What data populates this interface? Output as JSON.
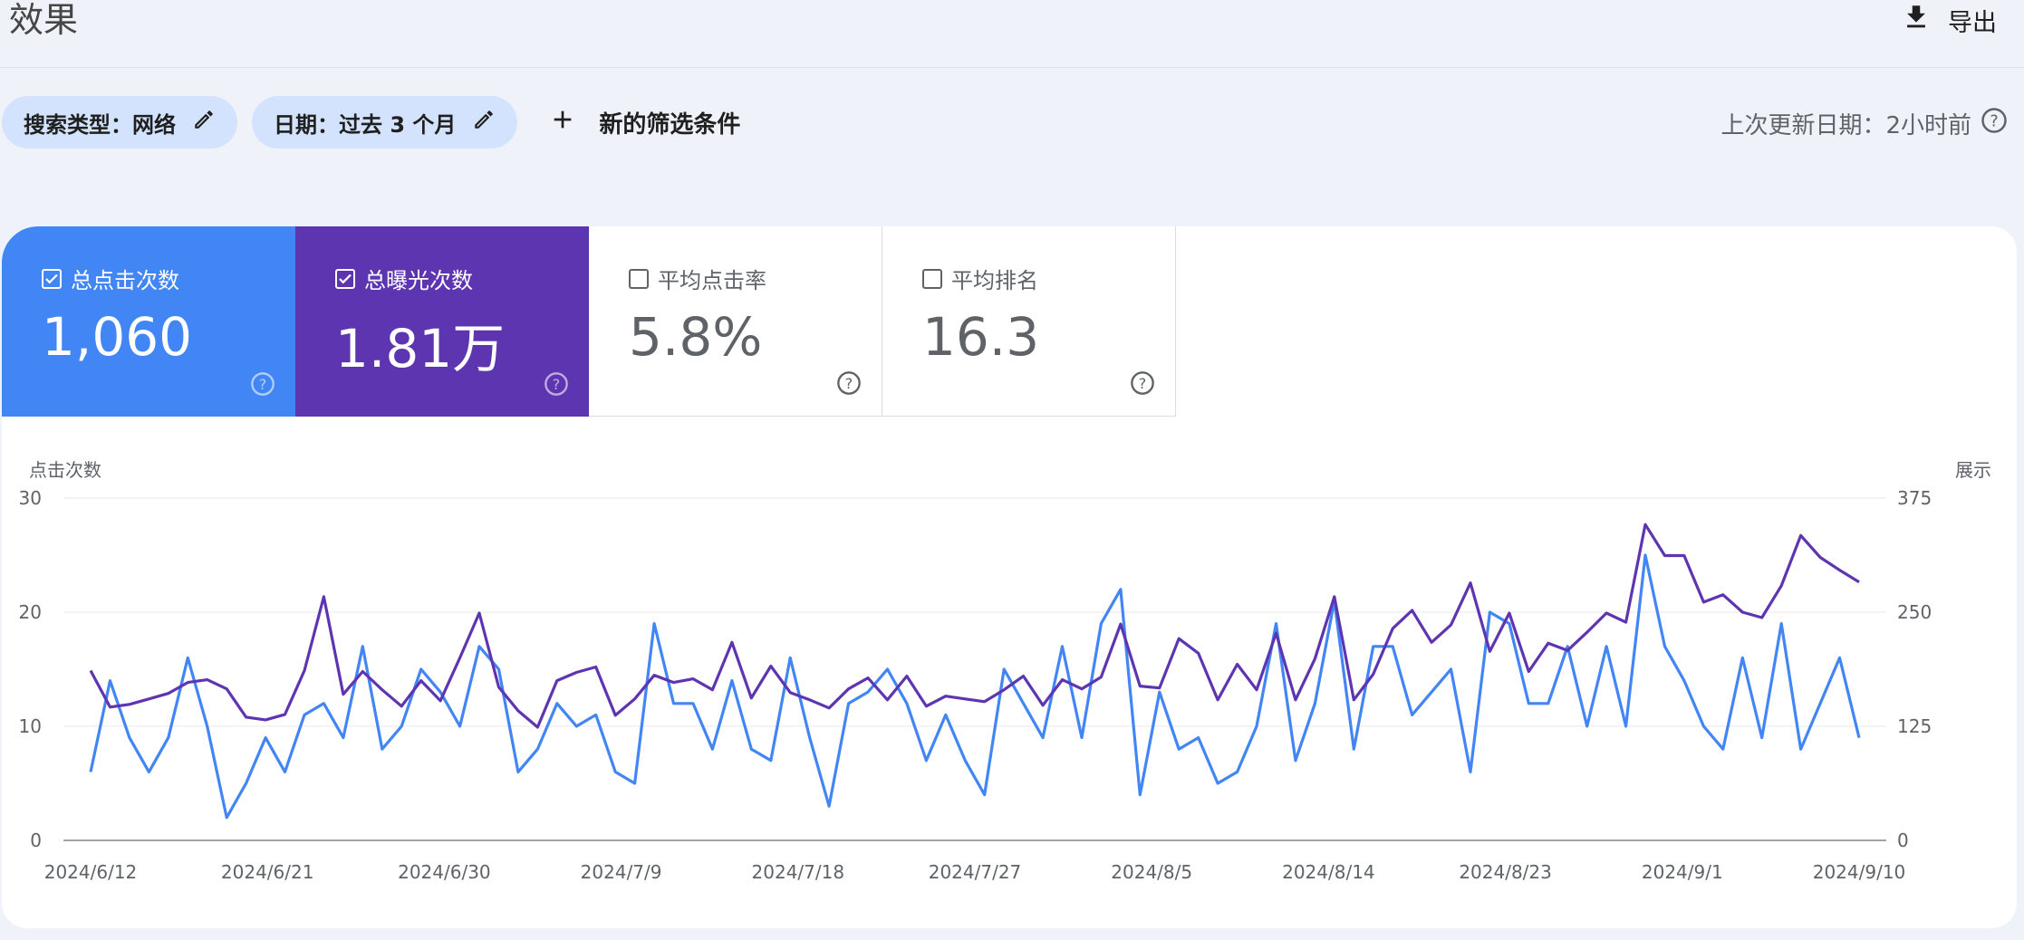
{
  "header": {
    "title": "效果",
    "export_label": "导出"
  },
  "filters": {
    "search_type": "搜索类型：网络",
    "date": "日期：过去 3 个月",
    "add_filter": "新的筛选条件",
    "last_updated": "上次更新日期：2小时前"
  },
  "metrics": [
    {
      "label": "总点击次数",
      "value": "1,060",
      "checked": true,
      "color": "#4285f4"
    },
    {
      "label": "总曝光次数",
      "value": "1.81万",
      "checked": true,
      "color": "#5e35b1"
    },
    {
      "label": "平均点击率",
      "value": "5.8%",
      "checked": false
    },
    {
      "label": "平均排名",
      "value": "16.3",
      "checked": false
    }
  ],
  "chart_data": {
    "type": "line",
    "ylabel_left": "点击次数",
    "ylabel_right": "展示",
    "ylim_left": [
      0,
      30
    ],
    "ylim_right": [
      0,
      375
    ],
    "yticks_left": [
      "0",
      "10",
      "20",
      "30"
    ],
    "yticks_right": [
      "0",
      "125",
      "250",
      "375"
    ],
    "grid": true,
    "xtick_labels": [
      "2024/6/12",
      "2024/6/21",
      "2024/6/30",
      "2024/7/9",
      "2024/7/18",
      "2024/7/27",
      "2024/8/5",
      "2024/8/14",
      "2024/8/23",
      "2024/9/1",
      "2024/9/10"
    ],
    "x_start": "2024/6/12",
    "x_end": "2024/9/10",
    "series": [
      {
        "name": "总点击次数",
        "axis": "left",
        "color": "#4285f4",
        "values": [
          6,
          14,
          9,
          6,
          9,
          16,
          10,
          2,
          5,
          9,
          6,
          11,
          12,
          9,
          17,
          8,
          10,
          15,
          13,
          10,
          17,
          15,
          6,
          8,
          12,
          10,
          11,
          6,
          5,
          19,
          12,
          12,
          8,
          14,
          8,
          7,
          16,
          9,
          3,
          12,
          13,
          15,
          12,
          7,
          11,
          7,
          4,
          15,
          12,
          9,
          17,
          9,
          19,
          22,
          4,
          13,
          8,
          9,
          5,
          6,
          10,
          19,
          7,
          12,
          21,
          8,
          17,
          17,
          11,
          13,
          15,
          6,
          20,
          19,
          12,
          12,
          17,
          10,
          17,
          10,
          25,
          17,
          14,
          10,
          8,
          16,
          9,
          19,
          8,
          12,
          16,
          9
        ]
      },
      {
        "name": "总曝光次数",
        "axis": "right",
        "color": "#5e35b1",
        "values": [
          186,
          146,
          149,
          155,
          161,
          173,
          176,
          166,
          135,
          132,
          138,
          186,
          267,
          160,
          185,
          165,
          147,
          175,
          153,
          200,
          249,
          168,
          142,
          124,
          175,
          184,
          190,
          137,
          155,
          181,
          173,
          177,
          165,
          217,
          156,
          191,
          162,
          154,
          145,
          166,
          178,
          154,
          180,
          147,
          158,
          155,
          152,
          165,
          180,
          148,
          176,
          166,
          179,
          237,
          169,
          167,
          221,
          205,
          154,
          193,
          165,
          227,
          154,
          199,
          267,
          154,
          182,
          232,
          252,
          217,
          236,
          282,
          207,
          249,
          185,
          216,
          208,
          228,
          249,
          239,
          346,
          312,
          312,
          261,
          269,
          250,
          244,
          279,
          334,
          310,
          296,
          283
        ]
      }
    ]
  }
}
